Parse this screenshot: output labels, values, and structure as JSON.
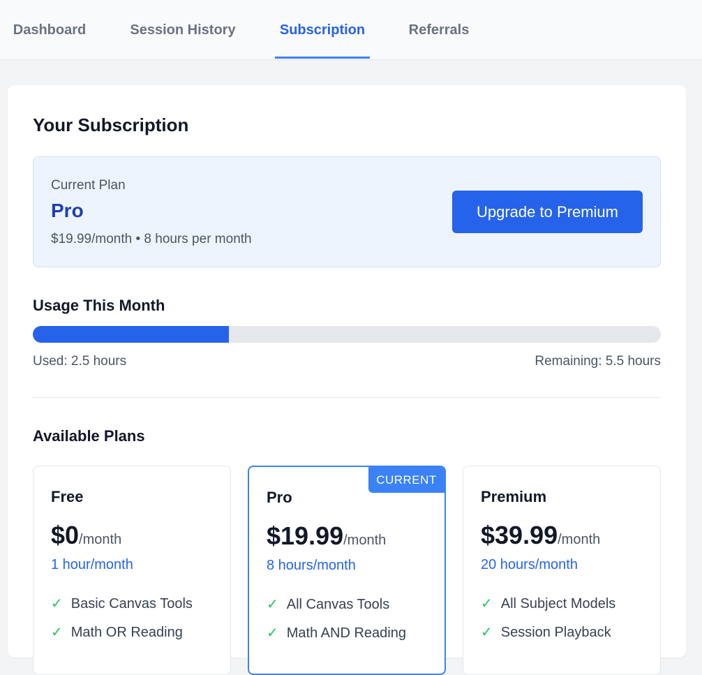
{
  "tabs": [
    {
      "label": "Dashboard",
      "active": false
    },
    {
      "label": "Session History",
      "active": false
    },
    {
      "label": "Subscription",
      "active": true
    },
    {
      "label": "Referrals",
      "active": false
    }
  ],
  "subscription": {
    "title": "Your Subscription",
    "current_plan_label": "Current Plan",
    "current_plan_name": "Pro",
    "current_plan_detail": "$19.99/month • 8 hours per month",
    "upgrade_label": "Upgrade to Premium"
  },
  "usage": {
    "title": "Usage This Month",
    "used_label": "Used: 2.5 hours",
    "remaining_label": "Remaining: 5.5 hours",
    "used_hours": 2.5,
    "total_hours": 8
  },
  "plans_section": {
    "title": "Available Plans",
    "plans": [
      {
        "name": "Free",
        "price": "$0",
        "period": "/month",
        "hours": "1 hour/month",
        "current": false,
        "features": [
          "Basic Canvas Tools",
          "Math OR Reading"
        ]
      },
      {
        "name": "Pro",
        "price": "$19.99",
        "period": "/month",
        "hours": "8 hours/month",
        "current": true,
        "badge": "CURRENT",
        "features": [
          "All Canvas Tools",
          "Math AND Reading"
        ]
      },
      {
        "name": "Premium",
        "price": "$39.99",
        "period": "/month",
        "hours": "20 hours/month",
        "current": false,
        "features": [
          "All Subject Models",
          "Session Playback"
        ]
      }
    ]
  },
  "check_glyph": "✓",
  "colors": {
    "accent": "#2563eb",
    "check": "#22c55e",
    "plan_box_bg": "#eef4fd"
  }
}
